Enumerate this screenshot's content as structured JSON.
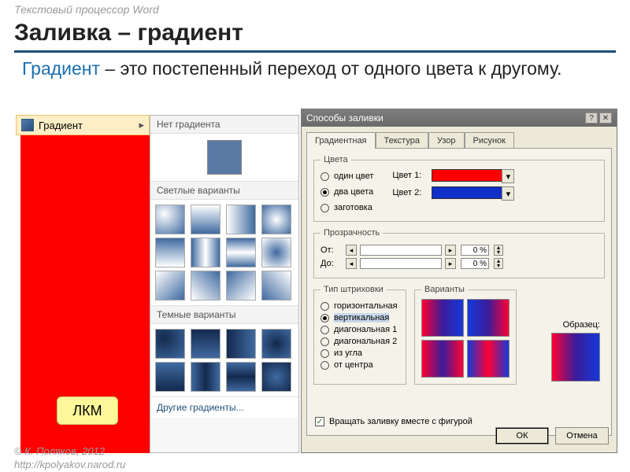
{
  "header_label": "Текстовый процессор Word",
  "title": "Заливка – градиент",
  "definition_keyword": "Градиент",
  "definition_rest": " – это постепенный переход от одного цвета к другому.",
  "footer_line1": "© К. Поляков, 2012",
  "footer_line2": "http://kpolyakov.narod.ru",
  "grad_button_label": "Градиент",
  "gallery": {
    "no_gradient": "Нет градиента",
    "light_variants": "Светлые варианты",
    "dark_variants": "Темные варианты",
    "more": "Другие градиенты..."
  },
  "lkm": "ЛКМ",
  "dialog": {
    "title": "Способы заливки",
    "tabs": [
      "Градиентная",
      "Текстура",
      "Узор",
      "Рисунок"
    ],
    "colors_legend": "Цвета",
    "radio_one": "один цвет",
    "radio_two": "два цвета",
    "radio_preset": "заготовка",
    "color1_label": "Цвет 1:",
    "color2_label": "Цвет 2:",
    "color1": "#ff0000",
    "color2": "#1030c8",
    "transp_legend": "Прозрачность",
    "from_label": "От:",
    "to_label": "До:",
    "from_pct": "0 %",
    "to_pct": "0 %",
    "hatch_legend": "Тип штриховки",
    "hatch": {
      "h": "горизонтальная",
      "v": "вертикальная",
      "d1": "диагональная 1",
      "d2": "диагональная 2",
      "corner": "из угла",
      "center": "от центра"
    },
    "variants_legend": "Варианты",
    "sample_label": "Образец:",
    "rotate_cb": "Вращать заливку вместе с фигурой",
    "ok": "ОК",
    "cancel": "Отмена"
  }
}
